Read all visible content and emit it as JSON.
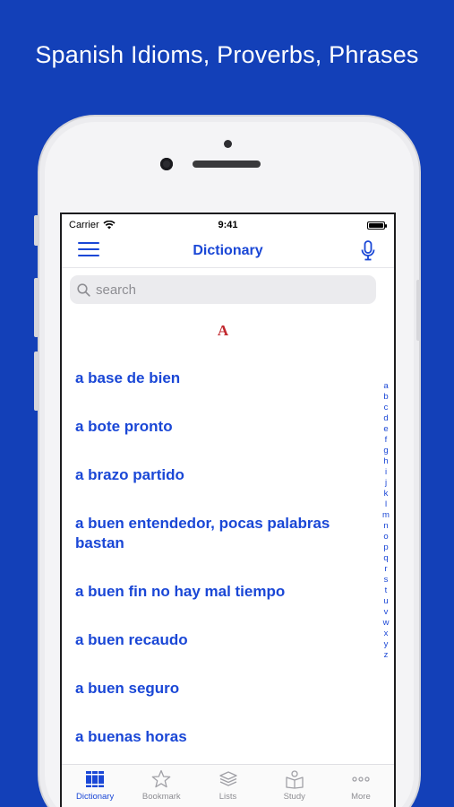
{
  "promo": {
    "headline": "Spanish Idioms, Proverbs, Phrases"
  },
  "status_bar": {
    "carrier": "Carrier",
    "time": "9:41"
  },
  "nav": {
    "title": "Dictionary",
    "menu_icon": "hamburger-icon",
    "mic_icon": "microphone-icon"
  },
  "search": {
    "placeholder": "search"
  },
  "section": {
    "letter": "A"
  },
  "entries": [
    {
      "text": "a base de bien"
    },
    {
      "text": "a bote pronto"
    },
    {
      "text": "a brazo partido"
    },
    {
      "text": "a buen entendedor, pocas palabras bastan"
    },
    {
      "text": "a buen fin no hay mal tiempo"
    },
    {
      "text": "a buen recaudo"
    },
    {
      "text": "a buen seguro"
    },
    {
      "text": "a buenas horas"
    }
  ],
  "index": [
    "a",
    "b",
    "c",
    "d",
    "e",
    "f",
    "g",
    "h",
    "i",
    "j",
    "k",
    "l",
    "m",
    "n",
    "o",
    "p",
    "q",
    "r",
    "s",
    "t",
    "u",
    "v",
    "w",
    "x",
    "y",
    "z"
  ],
  "tabs": [
    {
      "label": "Dictionary",
      "icon": "books-icon",
      "active": true
    },
    {
      "label": "Bookmark",
      "icon": "star-icon",
      "active": false
    },
    {
      "label": "Lists",
      "icon": "stack-icon",
      "active": false
    },
    {
      "label": "Study",
      "icon": "book-reader-icon",
      "active": false
    },
    {
      "label": "More",
      "icon": "ellipsis-icon",
      "active": false
    }
  ],
  "colors": {
    "background": "#1340b8",
    "accent": "#1a47d6",
    "section_letter": "#c1272d"
  }
}
